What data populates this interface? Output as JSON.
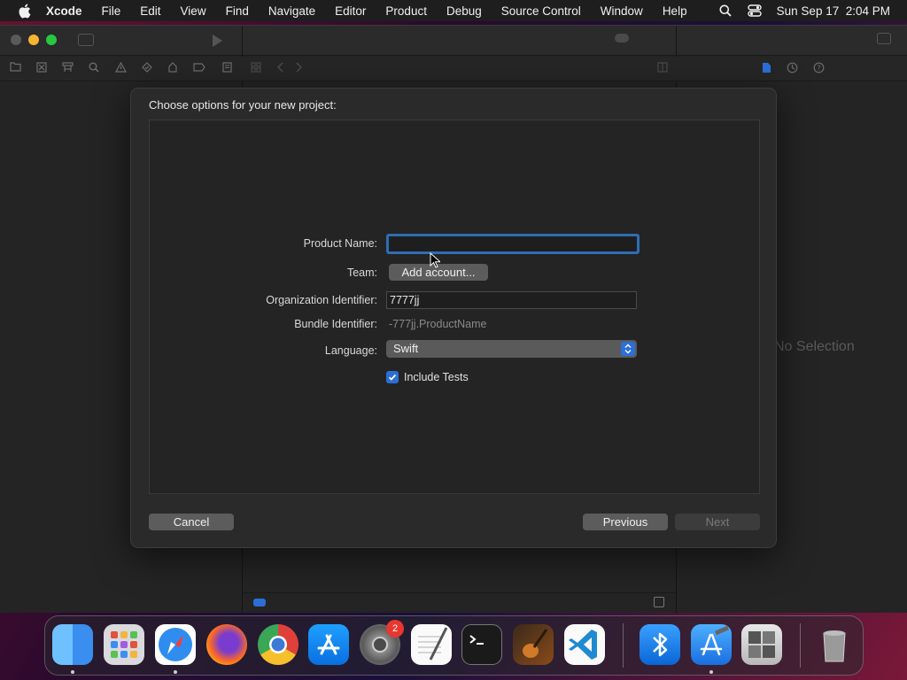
{
  "menubar": {
    "app_name": "Xcode",
    "items": [
      "File",
      "Edit",
      "View",
      "Find",
      "Navigate",
      "Editor",
      "Product",
      "Debug",
      "Source Control",
      "Window",
      "Help"
    ],
    "clock": "Sun Sep 17  2:04 PM"
  },
  "inspector": {
    "empty_state": "No Selection"
  },
  "dialog": {
    "title": "Choose options for your new project:",
    "product_name": {
      "label": "Product Name:",
      "value": ""
    },
    "team": {
      "label": "Team:",
      "button": "Add account..."
    },
    "org_id": {
      "label": "Organization Identifier:",
      "value": "7777jj"
    },
    "bundle_id": {
      "label": "Bundle Identifier:",
      "value": "-777jj.ProductName"
    },
    "language": {
      "label": "Language:",
      "value": "Swift"
    },
    "include_tests": {
      "label": "Include Tests",
      "checked": true
    },
    "buttons": {
      "cancel": "Cancel",
      "previous": "Previous",
      "next": "Next"
    }
  },
  "dock": {
    "apps": [
      "finder",
      "launchpad",
      "safari",
      "firefox",
      "chrome",
      "app-store",
      "system-settings",
      "textedit",
      "terminal",
      "garageband",
      "vscode",
      "bluetooth-file-exchange",
      "xcode",
      "boot-camp-assistant",
      "trash"
    ],
    "system_settings_badge": "2"
  },
  "colors": {
    "accent": "#2b6fd6",
    "focus_ring": "#2e6db5",
    "dialog_bg": "#2a2a2a",
    "menubar_bg": "#1e1e1e"
  }
}
